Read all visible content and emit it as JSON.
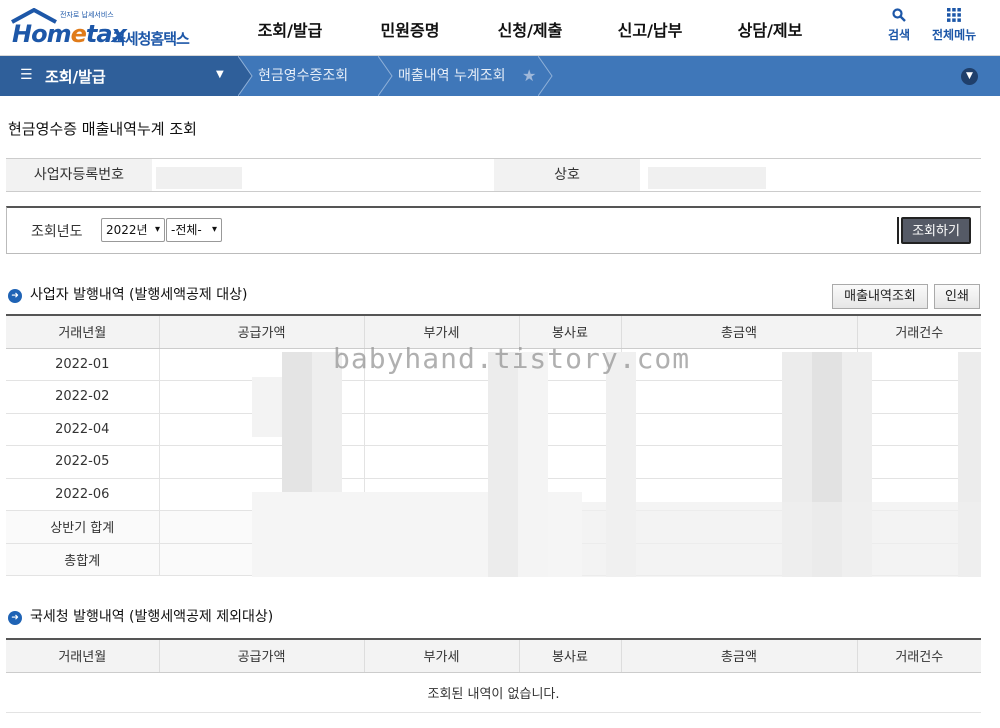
{
  "header": {
    "logo_small": "전자로 납세서비스",
    "logo_home": "Hom",
    "logo_e": "e",
    "logo_tax": "tax",
    "logo_korean": "국세청홈택스",
    "nav": [
      "조회/발급",
      "민원증명",
      "신청/제출",
      "신고/납부",
      "상담/제보"
    ],
    "search_label": "검색",
    "menu_label": "전체메뉴"
  },
  "breadcrumb": {
    "main": "조회/발급",
    "items": [
      "현금영수증조회",
      "매출내역 누계조회"
    ]
  },
  "page_title": "현금영수증 매출내역누계 조회",
  "info": {
    "bizno_label": "사업자등록번호",
    "name_label": "상호"
  },
  "search": {
    "label": "조회년도",
    "year": "2022년",
    "period": "-전체-",
    "button": "조회하기"
  },
  "section1": {
    "title": "사업자 발행내역 (발행세액공제 대상)",
    "btn_sales": "매출내역조회",
    "btn_print": "인쇄",
    "columns": [
      "거래년월",
      "공급가액",
      "부가세",
      "봉사료",
      "총금액",
      "거래건수"
    ],
    "rows": [
      "2022-01",
      "2022-02",
      "2022-04",
      "2022-05",
      "2022-06",
      "상반기 합계",
      "총합계"
    ]
  },
  "section2": {
    "title": "국세청 발행내역 (발행세액공제 제외대상)",
    "columns": [
      "거래년월",
      "공급가액",
      "부가세",
      "봉사료",
      "총금액",
      "거래건수"
    ],
    "empty": "조회된 내역이 없습니다."
  },
  "watermark": "babyhand.tistory.com"
}
